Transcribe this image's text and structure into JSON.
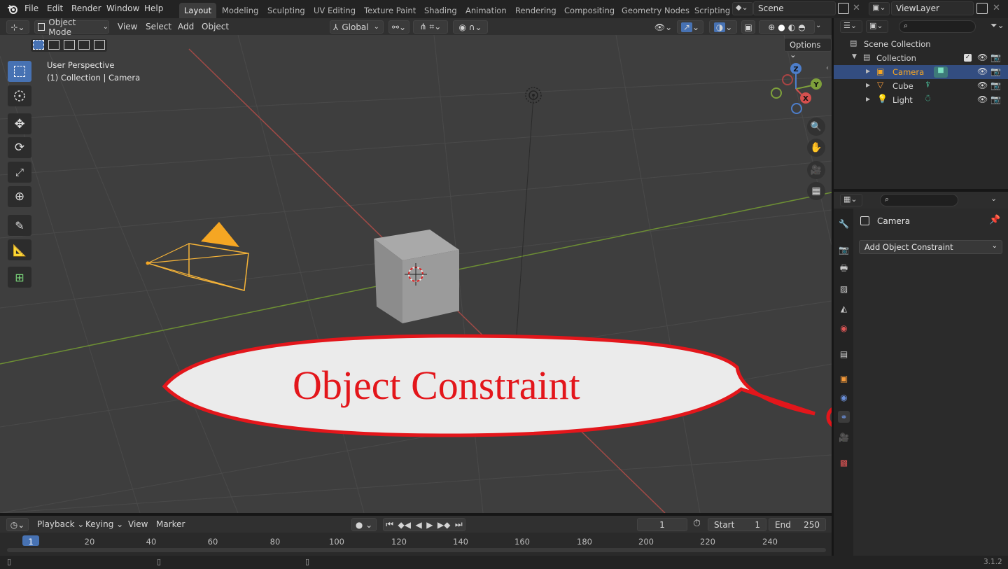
{
  "menu": {
    "items": [
      "File",
      "Edit",
      "Render",
      "Window",
      "Help"
    ]
  },
  "workspaces": [
    "Layout",
    "Modeling",
    "Sculpting",
    "UV Editing",
    "Texture Paint",
    "Shading",
    "Animation",
    "Rendering",
    "Compositing",
    "Geometry Nodes",
    "Scripting"
  ],
  "scene": {
    "name": "Scene"
  },
  "view_layer": {
    "name": "ViewLayer"
  },
  "viewport_header": {
    "mode": "Object Mode",
    "menus": [
      "View",
      "Select",
      "Add",
      "Object"
    ],
    "transform_orientation": "Global",
    "options_label": "Options"
  },
  "viewport": {
    "perspective_label": "User Perspective",
    "context_label": "(1) Collection | Camera",
    "gizmo_axes": {
      "z": "Z",
      "y": "Y",
      "x": "X"
    }
  },
  "callout": {
    "text": "Object Constraint"
  },
  "outliner": {
    "root": "Scene Collection",
    "collection": "Collection",
    "objects": [
      {
        "name": "Camera",
        "selected": true
      },
      {
        "name": "Cube",
        "selected": false
      },
      {
        "name": "Light",
        "selected": false
      }
    ]
  },
  "properties": {
    "object_name": "Camera",
    "add_constraint_label": "Add Object Constraint",
    "active_tab": "object-constraint"
  },
  "timeline": {
    "menus": [
      "Playback",
      "Keying",
      "View",
      "Marker"
    ],
    "current_frame": "1",
    "start_label": "Start",
    "start_value": "1",
    "end_label": "End",
    "end_value": "250",
    "ticks": [
      "1",
      "20",
      "40",
      "60",
      "80",
      "100",
      "120",
      "140",
      "160",
      "180",
      "200",
      "220",
      "240"
    ]
  },
  "status": {
    "version": "3.1.2"
  },
  "colors": {
    "accent_blue": "#4772b3",
    "selection_orange": "#f5a623",
    "callout_red": "#e3161b",
    "x_axis": "#b5413e",
    "y_axis": "#7ea03b"
  }
}
